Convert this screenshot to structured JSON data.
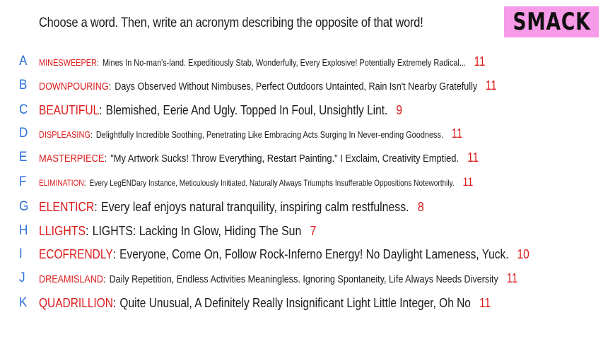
{
  "prompt": "Choose a word. Then, write an acronym describing the opposite of that word!",
  "logo": "SMACK",
  "colors": {
    "word": "#dd1b1b",
    "letter": "#2a70d9",
    "logo_bg": "#f79ae8",
    "text": "#1a1a1a"
  },
  "rows": [
    {
      "letter": "A",
      "word": "MINESWEEPER",
      "acronym": "Mines In No-man's-land. Expeditiously Stab, Wonderfully, Every Explosive! Potentially Extremely Radical...",
      "score": "11"
    },
    {
      "letter": "B",
      "word": "DOWNPOURING",
      "acronym": "Days Observed Without Nimbuses, Perfect Outdoors Untainted, Rain Isn't Nearby Gratefully",
      "score": "11"
    },
    {
      "letter": "C",
      "word": "BEAUTIFUL",
      "acronym": "Blemished, Eerie And Ugly. Topped In Foul, Unsightly Lint.",
      "score": "9"
    },
    {
      "letter": "D",
      "word": "DISPLEASING",
      "acronym": "Delightfully Incredible Soothing, Penetrating Like Embracing Acts Surging In Never-ending Goodness.",
      "score": "11"
    },
    {
      "letter": "E",
      "word": "MASTERPIECE",
      "acronym": "\"My Artwork Sucks! Throw Everything, Restart Painting.\" I Exclaim, Creativity Emptied.",
      "score": "11"
    },
    {
      "letter": "F",
      "word": "ELIMINATION",
      "acronym": "Every LegENDary Instance, Meticulously Initiated, Naturally Always Triumphs Insufferable Oppositions Noteworthily.",
      "score": "11"
    },
    {
      "letter": "G",
      "word": "ELENTICR",
      "acronym": "Every leaf enjoys natural tranquility, inspiring calm restfulness.",
      "score": "8"
    },
    {
      "letter": "H",
      "word": "LLIGHTS",
      "acronym": "LIGHTS: Lacking In Glow, Hiding The Sun",
      "score": "7"
    },
    {
      "letter": "I",
      "word": "ECOFRENDLY",
      "acronym": "Everyone, Come On, Follow Rock-Inferno Energy! No Daylight Lameness, Yuck.",
      "score": "10"
    },
    {
      "letter": "J",
      "word": "DREAMISLAND",
      "acronym": "Daily Repetition, Endless Activities Meaningless. Ignoring Spontaneity, Life Always Needs Diversity",
      "score": "11"
    },
    {
      "letter": "K",
      "word": "QUADRILLION",
      "acronym": "Quite Unusual, A Definitely Really Insignificant Light Little Integer, Oh No",
      "score": "11"
    }
  ]
}
